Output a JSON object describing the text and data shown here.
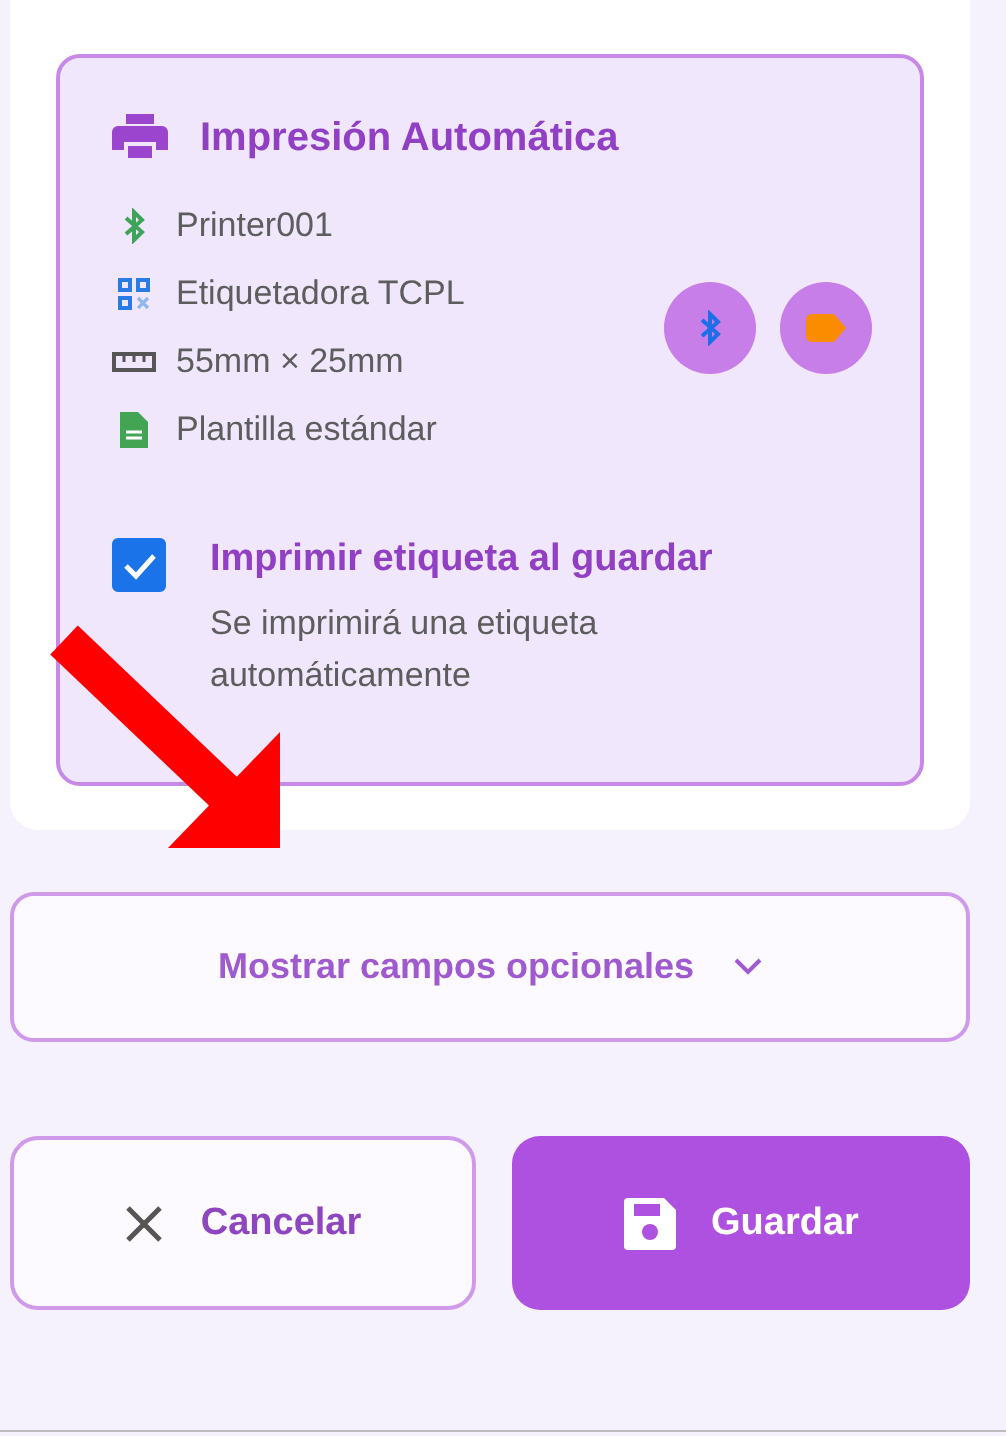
{
  "auto_print": {
    "title": "Impresión Automática",
    "details": [
      {
        "kind": "bluetooth",
        "text": "Printer001"
      },
      {
        "kind": "model",
        "text": "Etiquetadora TCPL"
      },
      {
        "kind": "size",
        "text": "55mm × 25mm"
      },
      {
        "kind": "template",
        "text": "Plantilla estándar"
      }
    ],
    "status_buttons": [
      {
        "kind": "bluetooth"
      },
      {
        "kind": "label"
      }
    ],
    "print_on_save": {
      "label": "Imprimir etiqueta al guardar",
      "description": "Se imprimirá una etiqueta automáticamente",
      "checked": true
    }
  },
  "optional_fields_toggle": {
    "label": "Mostrar campos opcionales",
    "expanded": false
  },
  "actions": [
    {
      "kind": "cancel",
      "label": "Cancelar"
    },
    {
      "kind": "save",
      "label": "Guardar"
    }
  ]
}
